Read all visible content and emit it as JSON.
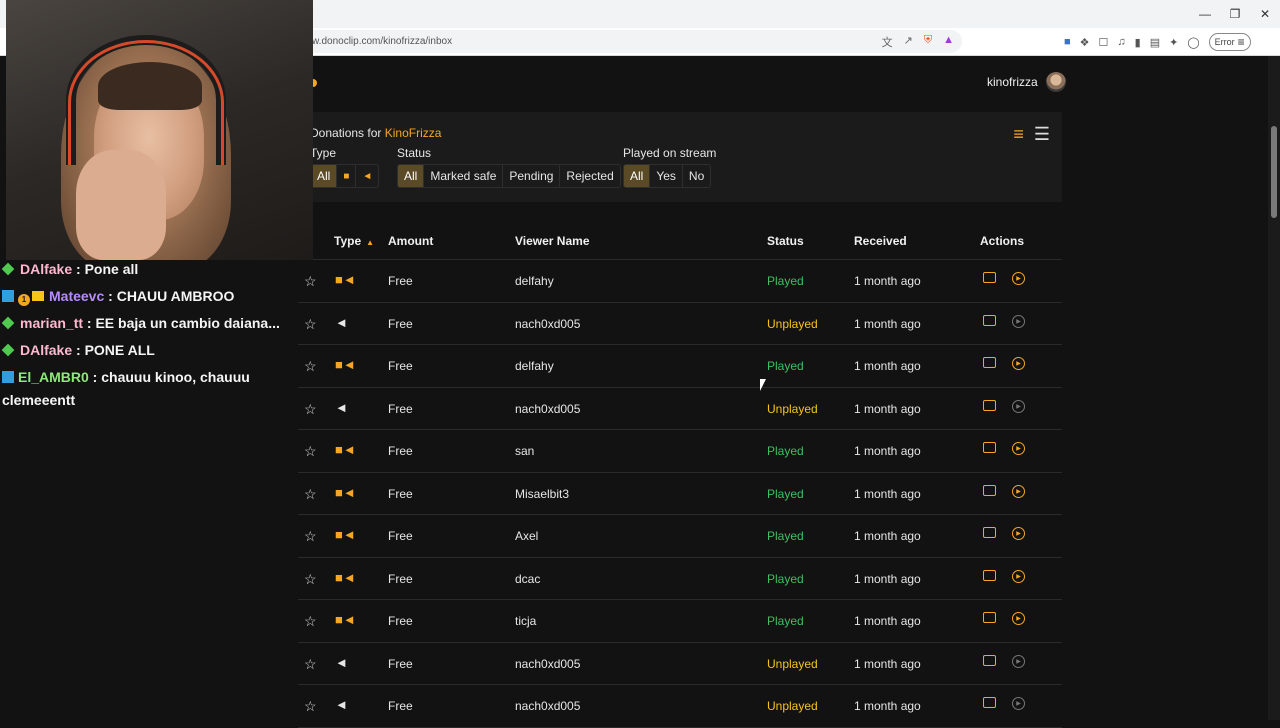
{
  "browser": {
    "url": "w.donoclip.com/kinofrizza/inbox",
    "error_label": "Error",
    "window_controls": [
      "minimize-icon",
      "restore-icon",
      "close-icon"
    ]
  },
  "header": {
    "username": "kinofrizza"
  },
  "filters": {
    "title_prefix": "Donations for ",
    "title_name": "KinoFrizza",
    "type_label": "Type",
    "type_options": [
      "All"
    ],
    "status_label": "Status",
    "status_options": [
      "All",
      "Marked safe",
      "Pending",
      "Rejected"
    ],
    "played_label": "Played on stream",
    "played_options": [
      "All",
      "Yes",
      "No"
    ]
  },
  "table": {
    "columns": {
      "type": "Type",
      "amount": "Amount",
      "viewer": "Viewer Name",
      "status": "Status",
      "received": "Received",
      "actions": "Actions"
    },
    "rows": [
      {
        "kind": "video",
        "amount": "Free",
        "viewer": "delfahy",
        "status": "Played",
        "received": "1 month ago"
      },
      {
        "kind": "audio",
        "amount": "Free",
        "viewer": "nach0xd005",
        "status": "Unplayed",
        "received": "1 month ago"
      },
      {
        "kind": "video",
        "amount": "Free",
        "viewer": "delfahy",
        "status": "Played",
        "received": "1 month ago"
      },
      {
        "kind": "audio",
        "amount": "Free",
        "viewer": "nach0xd005",
        "status": "Unplayed",
        "received": "1 month ago"
      },
      {
        "kind": "video",
        "amount": "Free",
        "viewer": "san",
        "status": "Played",
        "received": "1 month ago"
      },
      {
        "kind": "video",
        "amount": "Free",
        "viewer": "Misaelbit3",
        "status": "Played",
        "received": "1 month ago"
      },
      {
        "kind": "video",
        "amount": "Free",
        "viewer": "Axel",
        "status": "Played",
        "received": "1 month ago"
      },
      {
        "kind": "video",
        "amount": "Free",
        "viewer": "dcac",
        "status": "Played",
        "received": "1 month ago"
      },
      {
        "kind": "video",
        "amount": "Free",
        "viewer": "ticja",
        "status": "Played",
        "received": "1 month ago"
      },
      {
        "kind": "audio",
        "amount": "Free",
        "viewer": "nach0xd005",
        "status": "Unplayed",
        "received": "1 month ago"
      },
      {
        "kind": "audio",
        "amount": "Free",
        "viewer": "nach0xd005",
        "status": "Unplayed",
        "received": "1 month ago"
      }
    ]
  },
  "chat": {
    "messages": [
      {
        "user": "DAlfake",
        "text": " : Pone all"
      },
      {
        "user": "Mateevc",
        "text": " : CHAUU AMBROO",
        "sub_months": "1"
      },
      {
        "user": "marian_tt",
        "text": " : EE baja un cambio daiana..."
      },
      {
        "user": "DAlfake",
        "text": " : PONE ALL"
      },
      {
        "user": "El_AMBR0",
        "text": " : chauuu kinoo, chauuu clemeeentt"
      }
    ]
  },
  "colors": {
    "accent": "#f5a623",
    "played": "#3fbf62",
    "unplayed": "#f5c518"
  }
}
